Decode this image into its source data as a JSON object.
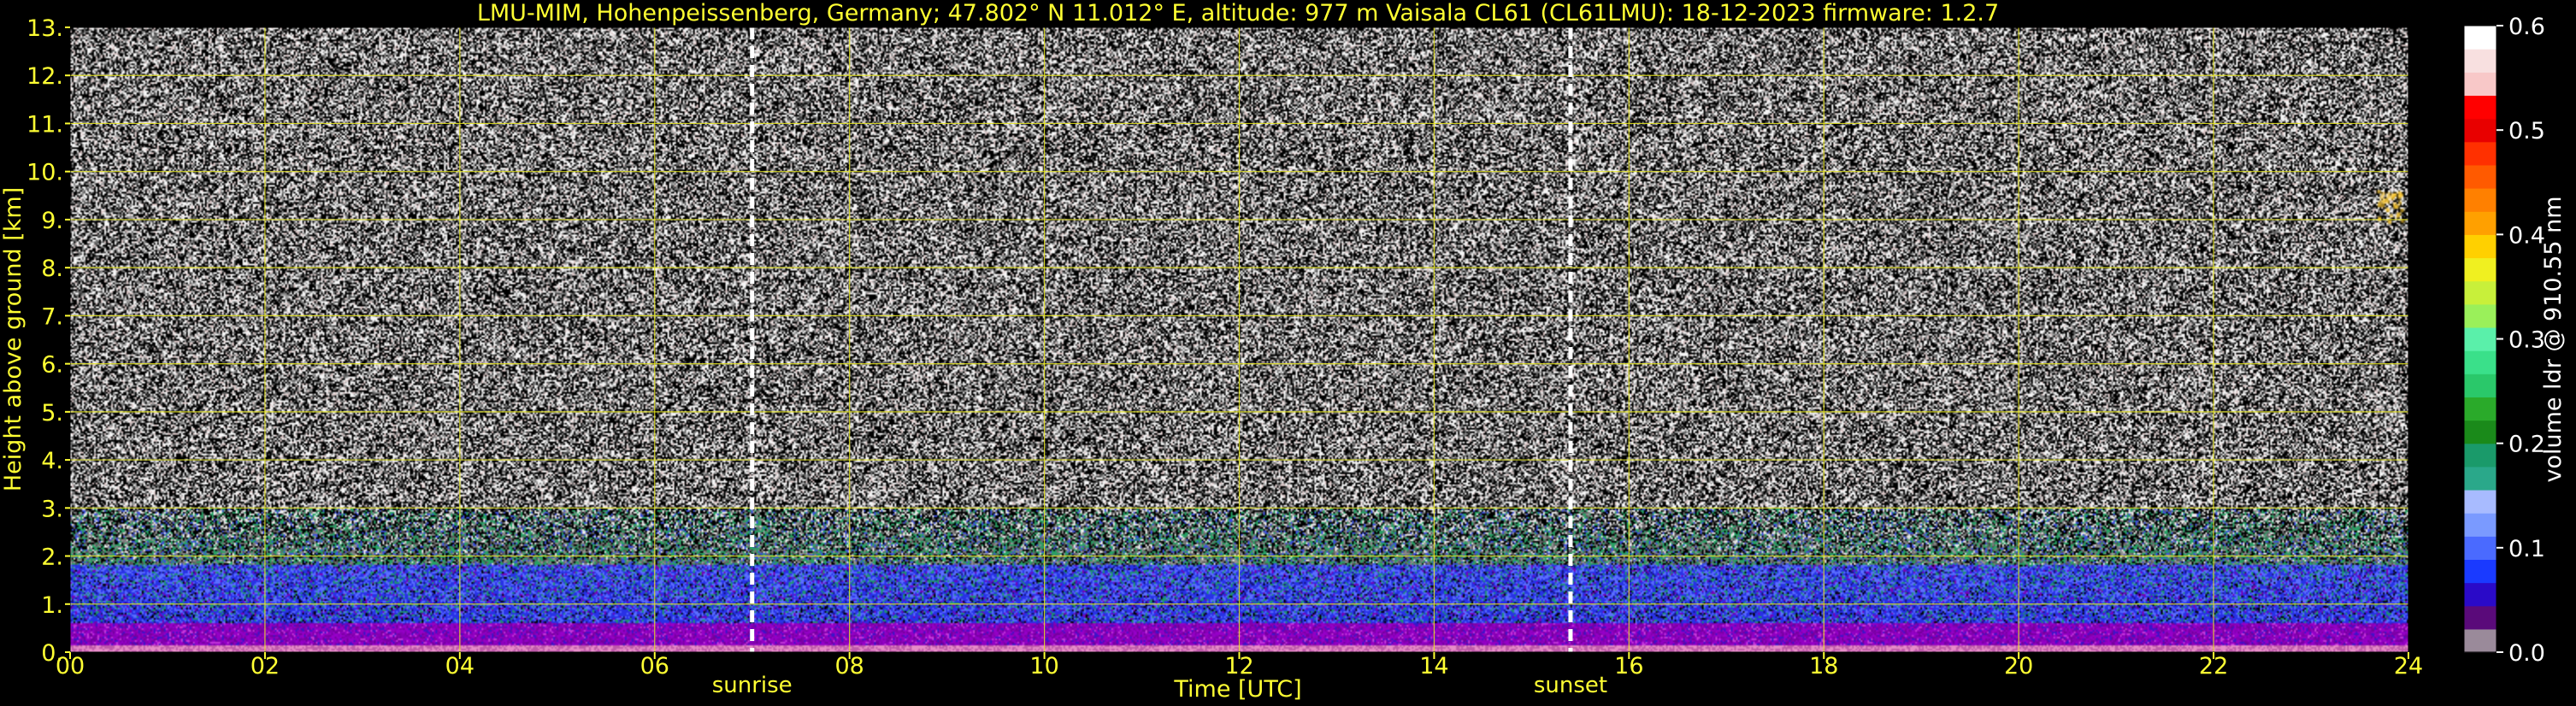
{
  "chart_data": {
    "type": "heatmap",
    "title": "LMU-MIM, Hohenpeissenberg, Germany; 47.802° N 11.012° E, altitude: 977 m    Vaisala CL61 (CL61LMU): 18-12-2023    firmware: 1.2.7",
    "xlabel": "Time [UTC]",
    "ylabel": "Height above ground [km]",
    "xlim": [
      0,
      24
    ],
    "ylim": [
      0,
      13
    ],
    "x_ticks": [
      "00",
      "02",
      "04",
      "06",
      "08",
      "10",
      "12",
      "14",
      "16",
      "18",
      "20",
      "22",
      "24"
    ],
    "y_ticks": [
      "0.",
      "1.",
      "2.",
      "3.",
      "4.",
      "5.",
      "6.",
      "7.",
      "8.",
      "9.",
      "10.",
      "11.",
      "12.",
      "13."
    ],
    "grid": true,
    "annotations": [
      {
        "label": "sunrise",
        "x": 7.0
      },
      {
        "label": "sunset",
        "x": 15.4
      }
    ],
    "colorbar": {
      "label": "volume ldr @ 910.55 nm",
      "range": [
        0.0,
        0.6
      ],
      "ticks": [
        "0.0",
        "0.1",
        "0.2",
        "0.3",
        "0.4",
        "0.5",
        "0.6"
      ],
      "colors": [
        "#9a8a9a",
        "#5a0a7a",
        "#2a0ac8",
        "#1a3aff",
        "#4a6aff",
        "#7a9aff",
        "#a8bbff",
        "#2aa88a",
        "#1a9a6a",
        "#1a8a1a",
        "#2aaa2a",
        "#2ac86a",
        "#3ae08a",
        "#5af0aa",
        "#9af05a",
        "#c8f03a",
        "#f0f020",
        "#ffd000",
        "#ffa000",
        "#ff8000",
        "#ff5a00",
        "#ff3000",
        "#e80000",
        "#ff0000",
        "#f8c8c8",
        "#f8e0e0",
        "#ffffff"
      ]
    },
    "layers": [
      {
        "name": "noise",
        "y_range": [
          2.5,
          13
        ],
        "dominant": "white/grey speckle"
      },
      {
        "name": "transition",
        "y_range": [
          1.8,
          3.0
        ],
        "dominant": "green/grey speckle"
      },
      {
        "name": "boundary layer",
        "y_range": [
          0.6,
          1.8
        ],
        "dominant": "blue"
      },
      {
        "name": "near surface",
        "y_range": [
          0.0,
          0.6
        ],
        "dominant": "purple/magenta"
      }
    ],
    "features": [
      {
        "x": 23.8,
        "y": 9.3,
        "color": "#ffcc33",
        "note": "small orange patch"
      }
    ]
  }
}
